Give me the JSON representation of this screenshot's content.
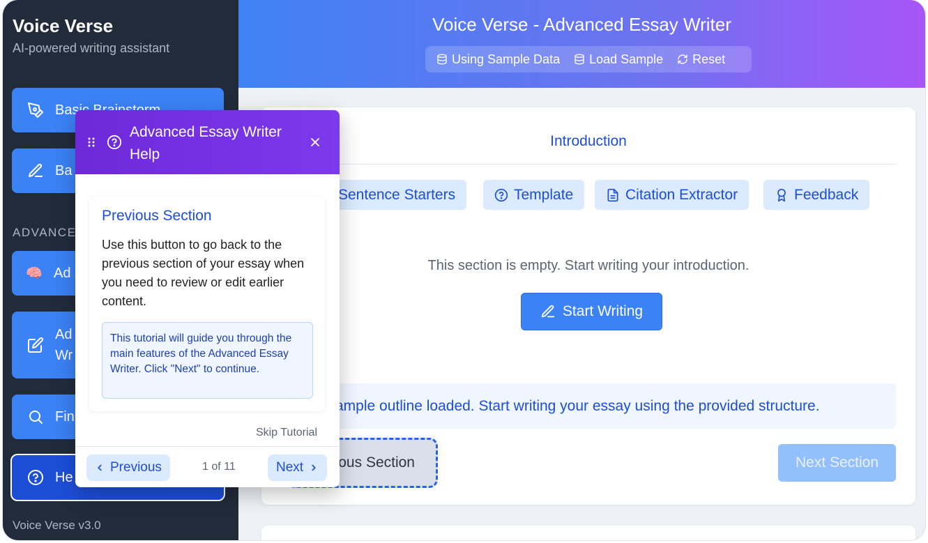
{
  "app": {
    "name": "Voice Verse",
    "tagline": "AI-powered writing assistant",
    "version": "Voice Verse v3.0"
  },
  "sidebar": {
    "items": [
      {
        "label": "Basic Brainstorm",
        "icon": "pen-nib-icon"
      },
      {
        "label": "Ba",
        "icon": "pencil-icon"
      },
      {
        "label": "Ad",
        "icon": "brain-emoji-icon"
      },
      {
        "label": "Ad\nWr",
        "icon": "edit-square-icon"
      },
      {
        "label": "Fin",
        "icon": "search-icon"
      },
      {
        "label": "He",
        "icon": "help-circle-icon"
      }
    ],
    "section_label": "ADVANCE",
    "emoji": "🧠"
  },
  "header": {
    "title": "Voice Verse - Advanced Essay Writer",
    "toolbar": {
      "sample_status": "Using Sample Data",
      "load_sample": "Load Sample",
      "reset": "Reset"
    }
  },
  "main": {
    "section_title": "Introduction",
    "tools": [
      "Sentence Starters",
      "Template",
      "Citation Extractor",
      "Feedback"
    ],
    "empty_text": "This section is empty. Start writing your introduction.",
    "start_button": "Start Writing",
    "notice": "ample outline loaded. Start writing your essay using the provided structure.",
    "previous_section": "ous Section",
    "next_section": "Next Section"
  },
  "popup": {
    "title": "Advanced Essay Writer Help",
    "step_title": "Previous Section",
    "step_body": "Use this button to go back to the previous section of your essay when you need to review or edit earlier content.",
    "tip": "This tutorial will guide you through the main features of the Advanced Essay Writer. Click \"Next\" to continue.",
    "skip": "Skip Tutorial",
    "prev": "Previous",
    "next": "Next",
    "counter": "1 of 11"
  },
  "colors": {
    "sidebar_bg": "#212b3a",
    "accent_blue": "#3b82f6",
    "active_blue": "#1d4ed8",
    "header_gradient_start": "#3f82f3",
    "header_gradient_end": "#a855f7",
    "popup_header": "#7c3aed"
  }
}
